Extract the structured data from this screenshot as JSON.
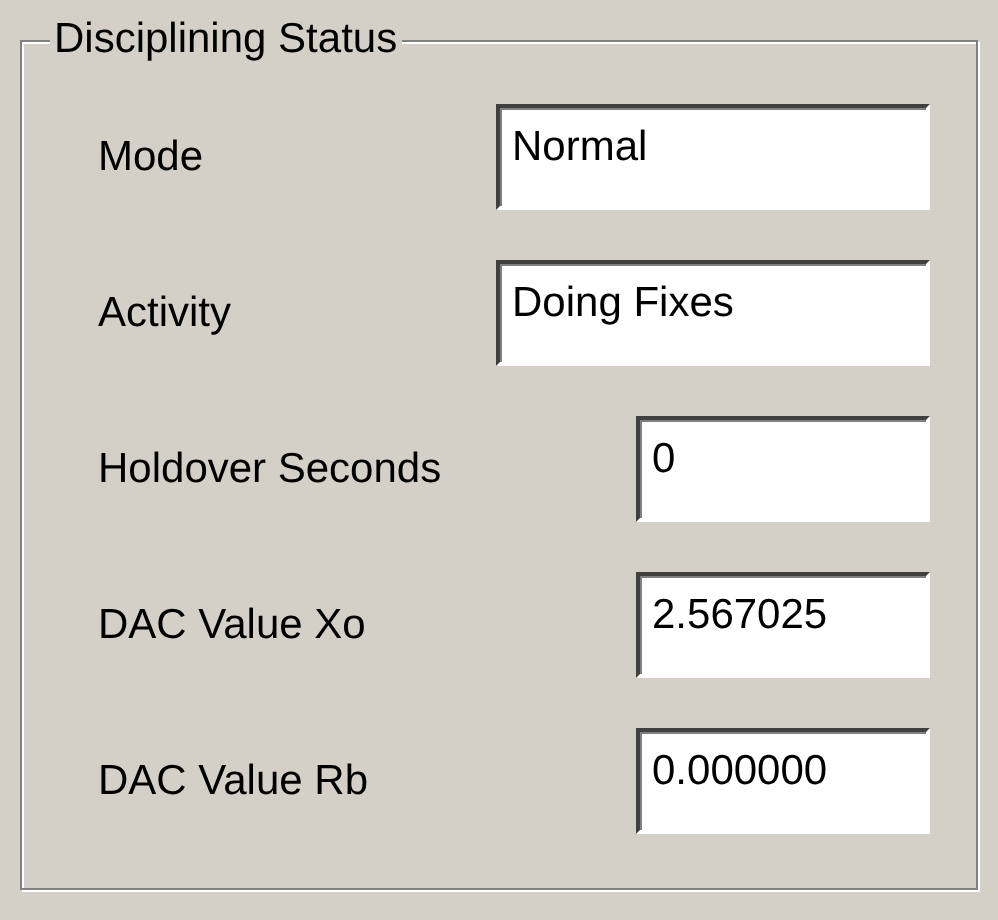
{
  "group_box": {
    "title": "Disciplining Status",
    "fields": [
      {
        "label": "Mode",
        "value": "Normal",
        "kind": "wide"
      },
      {
        "label": "Activity",
        "value": "Doing Fixes",
        "kind": "wide"
      },
      {
        "label": "Holdover Seconds",
        "value": "0",
        "kind": "narrow"
      },
      {
        "label": "DAC Value Xo",
        "value": "2.567025",
        "kind": "narrow"
      },
      {
        "label": "DAC Value Rb",
        "value": "0.000000",
        "kind": "narrow"
      }
    ]
  }
}
